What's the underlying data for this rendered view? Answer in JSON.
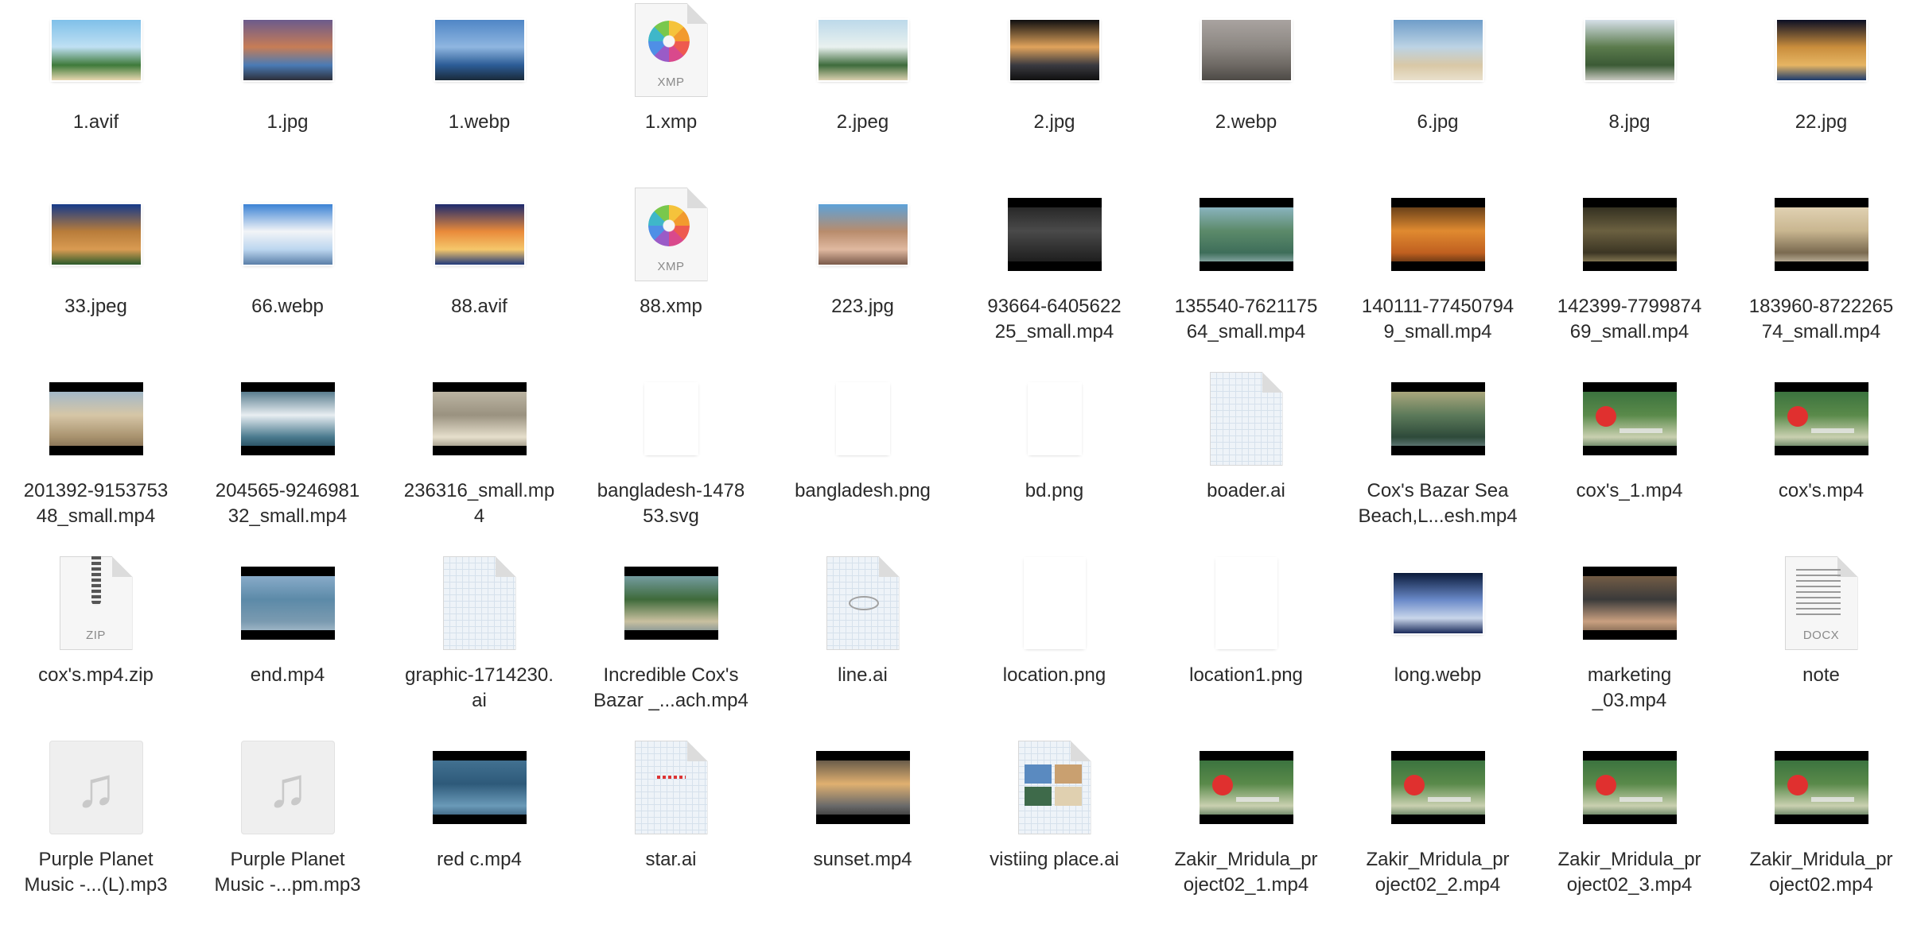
{
  "files": [
    {
      "name": "1.avif",
      "kind": "image",
      "colors": [
        "#7fc0e9",
        "#bfe0f3",
        "#3e7a3a",
        "#e7d7b0"
      ]
    },
    {
      "name": "1.jpg",
      "kind": "image",
      "colors": [
        "#6b5a8c",
        "#c77d56",
        "#4a7bb5",
        "#2d2f3a"
      ]
    },
    {
      "name": "1.webp",
      "kind": "image",
      "colors": [
        "#4f86c6",
        "#8fb6e0",
        "#2c5c96",
        "#1a2a3a"
      ]
    },
    {
      "name": "1.xmp",
      "kind": "photos-doc",
      "ext": "XMP"
    },
    {
      "name": "2.jpeg",
      "kind": "image",
      "colors": [
        "#bcd9ea",
        "#e9f1ef",
        "#3e6b3c",
        "#d9cfae"
      ]
    },
    {
      "name": "2.jpg",
      "kind": "image",
      "colors": [
        "#0f0f10",
        "#e0a35c",
        "#3a3a40",
        "#101010"
      ]
    },
    {
      "name": "2.webp",
      "kind": "image",
      "colors": [
        "#a9a3a0",
        "#8c8782",
        "#6e6964",
        "#4d4a46"
      ]
    },
    {
      "name": "6.jpg",
      "kind": "image",
      "colors": [
        "#6f9dc9",
        "#bcd3e4",
        "#d9c8a6",
        "#e9e0cc"
      ]
    },
    {
      "name": "8.jpg",
      "kind": "image",
      "colors": [
        "#d5dfe8",
        "#5b7b4d",
        "#3b5a35",
        "#c8c8c0"
      ]
    },
    {
      "name": "22.jpg",
      "kind": "image",
      "colors": [
        "#0b0f24",
        "#c98d3c",
        "#e6b563",
        "#1c3b6e"
      ]
    },
    {
      "name": "33.jpeg",
      "kind": "image",
      "colors": [
        "#153a8a",
        "#b87c3a",
        "#d99b52",
        "#2b5a2b"
      ]
    },
    {
      "name": "66.webp",
      "kind": "image",
      "colors": [
        "#3b82d4",
        "#f2f4f7",
        "#bcd6ef",
        "#5a7fa8"
      ]
    },
    {
      "name": "88.avif",
      "kind": "image",
      "colors": [
        "#1c2a6e",
        "#e98a3a",
        "#f5c76b",
        "#223a7a"
      ]
    },
    {
      "name": "88.xmp",
      "kind": "photos-doc",
      "ext": "XMP"
    },
    {
      "name": "223.jpg",
      "kind": "image",
      "colors": [
        "#5da2d9",
        "#b88c6c",
        "#e0b9a0",
        "#7a5a4a"
      ]
    },
    {
      "name": "93664-6405622\n25_small.mp4",
      "kind": "video",
      "colors": [
        "#1a1a1a",
        "#4a4a4a",
        "#2b2b2b",
        "#111111"
      ]
    },
    {
      "name": "135540-7621175\n64_small.mp4",
      "kind": "video",
      "colors": [
        "#9cc4e0",
        "#5c8a6a",
        "#3e6e5a",
        "#c9d9e6"
      ]
    },
    {
      "name": "140111-77450794\n9_small.mp4",
      "kind": "video",
      "colors": [
        "#3a2410",
        "#e08a30",
        "#c06020",
        "#20150a"
      ]
    },
    {
      "name": "142399-7799874\n69_small.mp4",
      "kind": "video",
      "colors": [
        "#1e1e14",
        "#6b6040",
        "#3c3624",
        "#c9b680"
      ]
    },
    {
      "name": "183960-8722265\n74_small.mp4",
      "kind": "video",
      "colors": [
        "#e9dcc0",
        "#c9b690",
        "#7a6a50",
        "#f2ead8"
      ]
    },
    {
      "name": "201392-9153753\n48_small.mp4",
      "kind": "video",
      "colors": [
        "#8fb3d6",
        "#d6c6a6",
        "#a8926e",
        "#6e5a44"
      ]
    },
    {
      "name": "204565-9246981\n32_small.mp4",
      "kind": "video",
      "colors": [
        "#1f4f66",
        "#e8eef2",
        "#4a7a8e",
        "#0d2e3e"
      ]
    },
    {
      "name": "236316_small.mp\n4",
      "kind": "video",
      "colors": [
        "#c9c2b0",
        "#9a9280",
        "#e6dfcc",
        "#6e6858"
      ]
    },
    {
      "name": "bangladesh-1478\n53.svg",
      "kind": "map-outline"
    },
    {
      "name": "bangladesh.png",
      "kind": "map-flag"
    },
    {
      "name": "bd.png",
      "kind": "map-outline"
    },
    {
      "name": "boader.ai",
      "kind": "ai-map"
    },
    {
      "name": "Cox's Bazar Sea\nBeach,L...esh.mp4",
      "kind": "video",
      "colors": [
        "#c9b98a",
        "#5c7a5a",
        "#2e4a3a",
        "#8aa0a8"
      ]
    },
    {
      "name": "cox's_1.mp4",
      "kind": "video-flag",
      "colors": [
        "#2f6a3a",
        "#5a8a4a",
        "#c9d0b0",
        "#1e4a2a"
      ]
    },
    {
      "name": "cox's.mp4",
      "kind": "video-flag",
      "colors": [
        "#2f6a3a",
        "#5a8a4a",
        "#c9d0b0",
        "#1e4a2a"
      ]
    },
    {
      "name": "cox's.mp4.zip",
      "kind": "zip",
      "ext": "ZIP"
    },
    {
      "name": "end.mp4",
      "kind": "video",
      "colors": [
        "#9ab8d6",
        "#5c8aa8",
        "#7a9ab0",
        "#c0d0dc"
      ]
    },
    {
      "name": "graphic-1714230.\nai",
      "kind": "ai-blank"
    },
    {
      "name": "Incredible Cox's\nBazar _...ach.mp4",
      "kind": "video",
      "colors": [
        "#8ab0c9",
        "#3e6a3a",
        "#c9c0a0",
        "#5a7a90"
      ]
    },
    {
      "name": "line.ai",
      "kind": "ai-line"
    },
    {
      "name": "location.png",
      "kind": "pin-green"
    },
    {
      "name": "location1.png",
      "kind": "pin-red"
    },
    {
      "name": "long.webp",
      "kind": "image",
      "colors": [
        "#0a1a3a",
        "#6a8ac9",
        "#c9d6ea",
        "#1a2a5a"
      ]
    },
    {
      "name": "marketing\n_03.mp4",
      "kind": "video",
      "colors": [
        "#8a6a4a",
        "#3a3a3a",
        "#c9a080",
        "#5a4a3a"
      ]
    },
    {
      "name": "note",
      "kind": "docx",
      "ext": "DOCX"
    },
    {
      "name": "Purple Planet\nMusic -...(L).mp3",
      "kind": "audio"
    },
    {
      "name": "Purple Planet\nMusic -...pm.mp3",
      "kind": "audio"
    },
    {
      "name": "red c.mp4",
      "kind": "video",
      "colors": [
        "#4a7a9a",
        "#2e5a7a",
        "#6a9ab8",
        "#1e3e5a"
      ]
    },
    {
      "name": "star.ai",
      "kind": "ai-star"
    },
    {
      "name": "sunset.mp4",
      "kind": "video",
      "colors": [
        "#3a3a3a",
        "#e0b070",
        "#6a6a6a",
        "#1e1e1e"
      ]
    },
    {
      "name": "vistiing place.ai",
      "kind": "ai-collage"
    },
    {
      "name": "Zakir_Mridula_pr\noject02_1.mp4",
      "kind": "video-flag",
      "colors": [
        "#2f6a3a",
        "#5a8a4a",
        "#c9d0b0",
        "#1e4a2a"
      ]
    },
    {
      "name": "Zakir_Mridula_pr\noject02_2.mp4",
      "kind": "video-flag",
      "colors": [
        "#2f6a3a",
        "#5a8a4a",
        "#c9d0b0",
        "#1e4a2a"
      ]
    },
    {
      "name": "Zakir_Mridula_pr\noject02_3.mp4",
      "kind": "video-flag",
      "colors": [
        "#2f6a3a",
        "#5a8a4a",
        "#c9d0b0",
        "#1e4a2a"
      ]
    },
    {
      "name": "Zakir_Mridula_pr\noject02.mp4",
      "kind": "video-flag",
      "colors": [
        "#2f6a3a",
        "#5a8a4a",
        "#c9d0b0",
        "#1e4a2a"
      ]
    }
  ]
}
